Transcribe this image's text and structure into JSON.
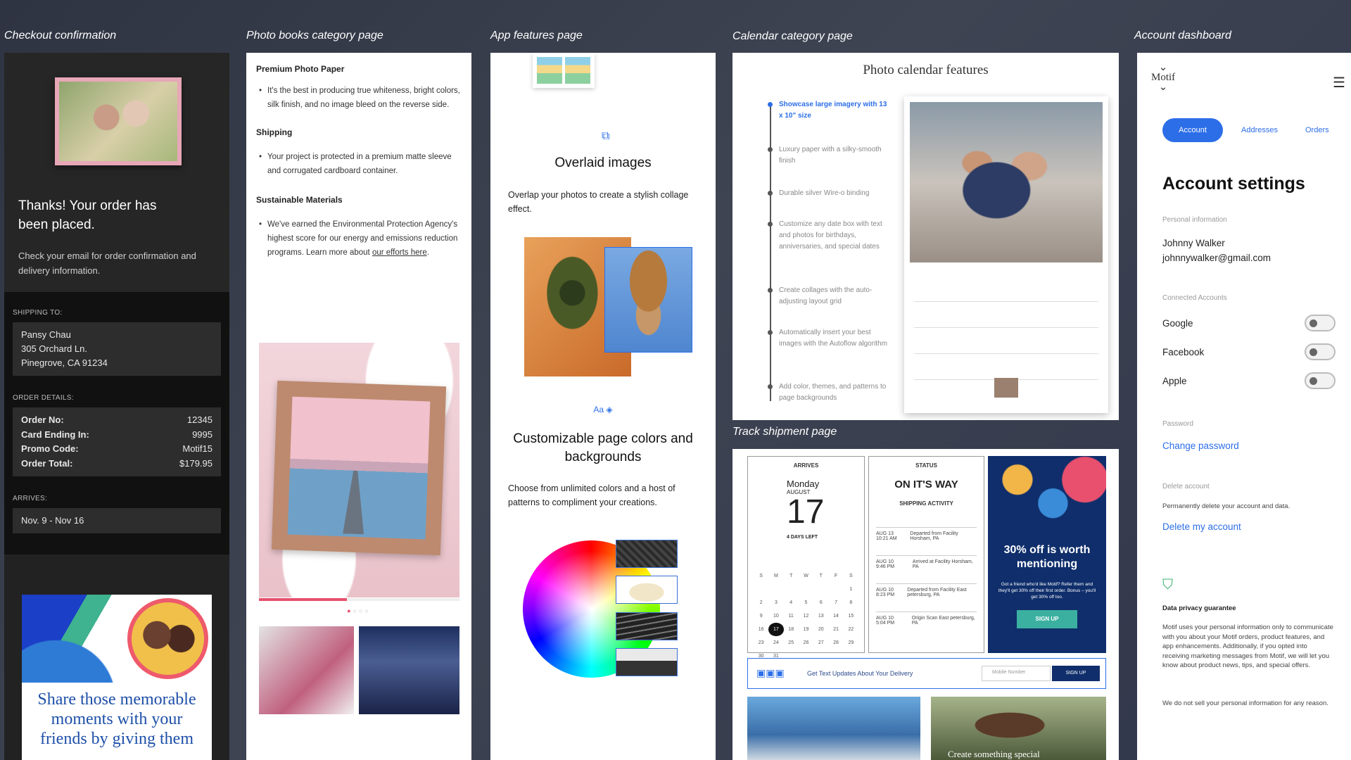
{
  "captions": {
    "checkout": "Checkout confirmation",
    "photo_books": "Photo books category page",
    "app_features": "App features page",
    "calendar": "Calendar category page",
    "account": "Account dashboard",
    "track": "Track shipment page"
  },
  "checkout": {
    "heading": "Thanks! Your order has been placed.",
    "subtext": "Check your email for order confirmation and delivery information.",
    "shipping_label": "SHIPPING TO:",
    "address": [
      "Pansy Chau",
      "305 Orchard Ln.",
      "Pinegrove, CA 91234"
    ],
    "order_label": "ORDER DETAILS:",
    "order_rows": [
      {
        "k": "Order No:",
        "v": "12345"
      },
      {
        "k": "Card Ending In:",
        "v": "9995"
      },
      {
        "k": "Promo Code:",
        "v": "Motif15"
      },
      {
        "k": "Order Total:",
        "v": "$179.95"
      }
    ],
    "arrives_label": "ARRIVES:",
    "arrives": "Nov. 9 - Nov 16",
    "promo_text": "Share those memorable moments with your friends by giving them"
  },
  "photo_books": {
    "sections": [
      {
        "title": "Premium Photo Paper",
        "text": "It's the best in producing true whiteness, bright colors, silk finish, and no image bleed on the reverse side."
      },
      {
        "title": "Shipping",
        "text": "Your project is protected in a premium matte sleeve and corrugated cardboard container."
      },
      {
        "title": "Sustainable Materials",
        "text": "We've earned the Environmental Protection Agency's highest score for our energy and emissions reduction programs. Learn more about ",
        "link": "our efforts here",
        "after": "."
      }
    ],
    "carousel_progress": 0.44
  },
  "app_features": {
    "feature1_title": "Overlaid images",
    "feature1_text": "Overlap your photos to create a stylish collage effect.",
    "feature2_icon": "Aa",
    "feature2_title": "Customizable page colors and backgrounds",
    "feature2_text": "Choose from unlimited colors and a host of patterns to compliment your creations."
  },
  "calendar": {
    "title": "Photo calendar features",
    "items": [
      "Showcase large imagery with 13 x 10\" size",
      "Luxury paper with a silky-smooth finish",
      "Durable silver Wire-o binding",
      "Customize any date box with text and photos for birthdays, anniversaries, and special dates",
      "Create collages with the auto-adjusting layout grid",
      "Automatically insert your best images with the Autoflow algorithm",
      "Add color, themes, and patterns to page backgrounds"
    ]
  },
  "account": {
    "logo": "Motif",
    "tabs": [
      "Account",
      "Addresses",
      "Orders"
    ],
    "title": "Account settings",
    "personal_label": "Personal information",
    "name": "Johnny Walker",
    "email": "johnnywalker@gmail.com",
    "connected_label": "Connected Accounts",
    "connected": [
      "Google",
      "Facebook",
      "Apple"
    ],
    "password_label": "Password",
    "change_password": "Change password",
    "delete_label": "Delete account",
    "delete_text": "Permanently delete your account and data.",
    "delete_link": "Delete my account",
    "privacy_title": "Data privacy guarantee",
    "privacy_text": "Motif uses your personal information only to communicate with you about your Motif orders, product features, and app enhancements. Additionally, if you opted into receiving marketing messages from Motif, we will let you know about product news, tips, and special offers.",
    "privacy_text2": "We do not sell your personal information for any reason."
  },
  "track": {
    "arrives_label": "ARRIVES",
    "day": "Monday",
    "month": "AUGUST",
    "date": "17",
    "days_left": "4 DAYS LEFT",
    "weekdays": [
      "S",
      "M",
      "T",
      "W",
      "T",
      "F",
      "S"
    ],
    "cal_days": [
      "",
      "",
      "",
      "",
      "",
      "",
      "1",
      "2",
      "3",
      "4",
      "5",
      "6",
      "7",
      "8",
      "9",
      "10",
      "11",
      "12",
      "13",
      "14",
      "15",
      "16",
      "17",
      "18",
      "19",
      "20",
      "21",
      "22",
      "23",
      "24",
      "25",
      "26",
      "27",
      "28",
      "29",
      "30",
      "31"
    ],
    "status_label": "STATUS",
    "status": "ON IT'S WAY",
    "activity_label": "SHIPPING ACTIVITY",
    "events": [
      {
        "when": "AUG 13 10:21 AM",
        "what": "Departed from Facility Horsham, PA"
      },
      {
        "when": "AUG 10 9:46 PM",
        "what": "Arrived at Facility Horsham, PA"
      },
      {
        "when": "AUG 10 8:23 PM",
        "what": "Departed from Facility East petersburg, PA"
      },
      {
        "when": "AUG 10 5:04 PM",
        "what": "Origin Scan East petersburg, PA"
      }
    ],
    "deal_title": "30% off is worth mentioning",
    "deal_text": "Got a friend who'd like Motif? Refer them and they'll get 30% off their first order. Bonus – you'll get 30% off too.",
    "deal_button": "SIGN UP",
    "text_updates": "Get Text Updates About Your Delivery",
    "mobile_placeholder": "Mobile Number",
    "bar_button": "SIGN UP",
    "bottom_caption": "Create something special"
  }
}
